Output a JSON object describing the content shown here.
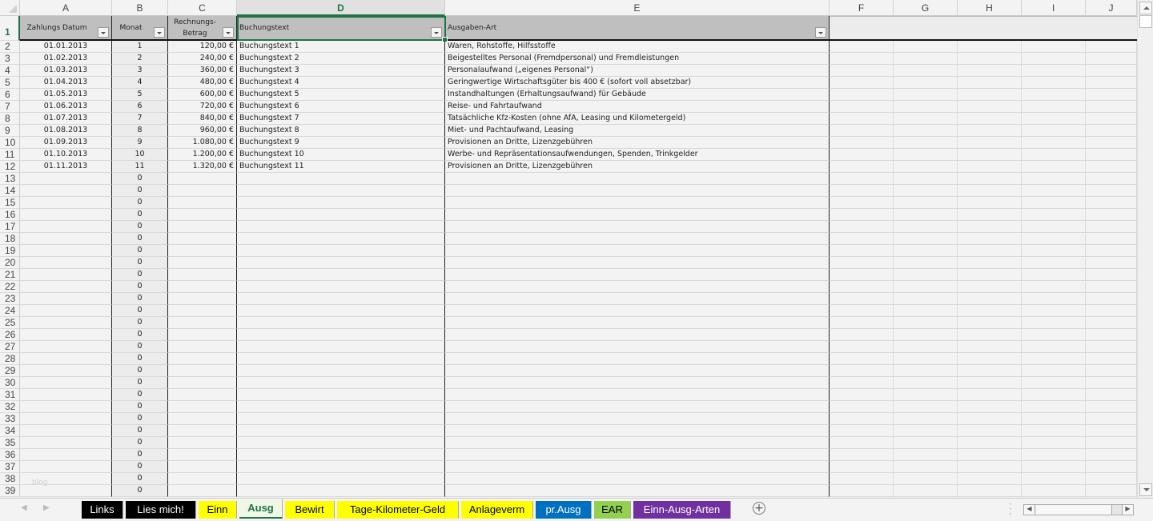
{
  "columns": [
    "A",
    "B",
    "C",
    "D",
    "E",
    "F",
    "G",
    "H",
    "I",
    "J"
  ],
  "selected_column": "D",
  "header": {
    "zahlungs_datum": "Zahlungs Datum",
    "monat": "Monat",
    "betrag_line1": "Rechnungs-",
    "betrag_line2": "Betrag",
    "buchungstext": "Buchungstext",
    "ausgaben_art": "Ausgaben-Art"
  },
  "rows": [
    {
      "n": "2",
      "datum": "01.01.2013",
      "monat": "1",
      "betrag": "120,00 €",
      "text": "Buchungstext 1",
      "art": "Waren, Rohstoffe, Hilfsstoffe"
    },
    {
      "n": "3",
      "datum": "01.02.2013",
      "monat": "2",
      "betrag": "240,00 €",
      "text": "Buchungstext 2",
      "art": "Beigestelltes Personal (Fremdpersonal) und Fremdleistungen"
    },
    {
      "n": "4",
      "datum": "01.03.2013",
      "monat": "3",
      "betrag": "360,00 €",
      "text": "Buchungstext 3",
      "art": "Personalaufwand („eigenes Personal“)"
    },
    {
      "n": "5",
      "datum": "01.04.2013",
      "monat": "4",
      "betrag": "480,00 €",
      "text": "Buchungstext 4",
      "art": "Geringwertige Wirtschaftsgüter bis 400 € (sofort voll absetzbar)"
    },
    {
      "n": "6",
      "datum": "01.05.2013",
      "monat": "5",
      "betrag": "600,00 €",
      "text": "Buchungstext 5",
      "art": "Instandhaltungen (Erhaltungsaufwand) für Gebäude"
    },
    {
      "n": "7",
      "datum": "01.06.2013",
      "monat": "6",
      "betrag": "720,00 €",
      "text": "Buchungstext 6",
      "art": "Reise- und Fahrtaufwand"
    },
    {
      "n": "8",
      "datum": "01.07.2013",
      "monat": "7",
      "betrag": "840,00 €",
      "text": "Buchungstext 7",
      "art": "Tatsächliche Kfz-Kosten (ohne AfA, Leasing und Kilometergeld)"
    },
    {
      "n": "9",
      "datum": "01.08.2013",
      "monat": "8",
      "betrag": "960,00 €",
      "text": "Buchungstext 8",
      "art": "Miet- und Pachtaufwand, Leasing"
    },
    {
      "n": "10",
      "datum": "01.09.2013",
      "monat": "9",
      "betrag": "1.080,00 €",
      "text": "Buchungstext 9",
      "art": "Provisionen an Dritte, Lizenzgebühren"
    },
    {
      "n": "11",
      "datum": "01.10.2013",
      "monat": "10",
      "betrag": "1.200,00 €",
      "text": "Buchungstext 10",
      "art": "Werbe- und Repräsentationsaufwendungen, Spenden, Trinkgelder"
    },
    {
      "n": "12",
      "datum": "01.11.2013",
      "monat": "11",
      "betrag": "1.320,00 €",
      "text": "Buchungstext 11",
      "art": "Provisionen an Dritte, Lizenzgebühren"
    },
    {
      "n": "13",
      "monat": "0"
    },
    {
      "n": "14",
      "monat": "0"
    },
    {
      "n": "15",
      "monat": "0"
    },
    {
      "n": "16",
      "monat": "0"
    },
    {
      "n": "17",
      "monat": "0"
    },
    {
      "n": "18",
      "monat": "0"
    },
    {
      "n": "19",
      "monat": "0"
    },
    {
      "n": "20",
      "monat": "0"
    },
    {
      "n": "21",
      "monat": "0"
    },
    {
      "n": "22",
      "monat": "0"
    },
    {
      "n": "23",
      "monat": "0"
    },
    {
      "n": "24",
      "monat": "0"
    },
    {
      "n": "25",
      "monat": "0"
    },
    {
      "n": "26",
      "monat": "0"
    },
    {
      "n": "27",
      "monat": "0"
    },
    {
      "n": "28",
      "monat": "0"
    },
    {
      "n": "29",
      "monat": "0"
    },
    {
      "n": "30",
      "monat": "0"
    },
    {
      "n": "31",
      "monat": "0"
    },
    {
      "n": "32",
      "monat": "0"
    },
    {
      "n": "33",
      "monat": "0"
    },
    {
      "n": "34",
      "monat": "0"
    },
    {
      "n": "35",
      "monat": "0"
    },
    {
      "n": "36",
      "monat": "0"
    },
    {
      "n": "37",
      "monat": "0"
    },
    {
      "n": "38",
      "monat": "0"
    },
    {
      "n": "39",
      "monat": "0"
    }
  ],
  "watermark": "blog",
  "tabs": [
    {
      "label": "Links",
      "bg": "#000000",
      "fg": "#ffffff"
    },
    {
      "label": "Lies mich!",
      "bg": "#000000",
      "fg": "#ffffff"
    },
    {
      "label": "Einn",
      "bg": "#ffff00",
      "fg": "#000000"
    },
    {
      "label": "Ausg",
      "bg": "#f0f7e6",
      "fg": "#217346",
      "active": true
    },
    {
      "label": "Bewirt",
      "bg": "#ffff00",
      "fg": "#000000"
    },
    {
      "label": "Tage-Kilometer-Geld",
      "bg": "#ffff00",
      "fg": "#000000"
    },
    {
      "label": "Anlageverm",
      "bg": "#ffff00",
      "fg": "#000000"
    },
    {
      "label": "pr.Ausg",
      "bg": "#0070c0",
      "fg": "#ffffff"
    },
    {
      "label": "EAR",
      "bg": "#92d050",
      "fg": "#000000"
    },
    {
      "label": "Einn-Ausg-Arten",
      "bg": "#7030a0",
      "fg": "#ffffff"
    }
  ]
}
